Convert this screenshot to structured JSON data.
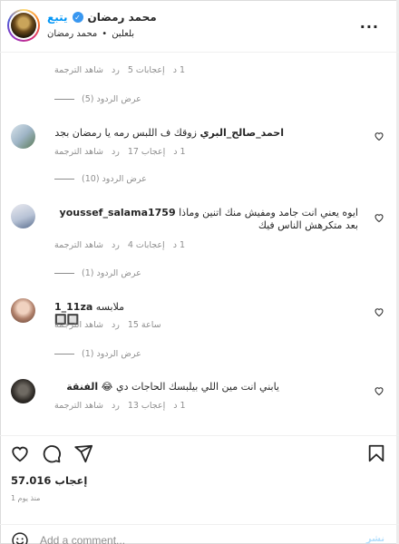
{
  "header": {
    "follow_label": "يتبع",
    "username": "محمد رمضان",
    "sub_location": "محمد رمضان",
    "sub_separator": "•",
    "sub_tag": "بلعلبن",
    "more_icon": "more-horizontal-icon"
  },
  "comments": [
    {
      "meta": {
        "time": "1 د",
        "likes": "إعجابات 5",
        "reply": "رد",
        "translate": "شاهد الترجمة"
      },
      "view_replies": "عرض الردود (5)"
    },
    {
      "username": "احمد_صالح_البري",
      "text": "زوقك ف اللبس رمه يا رمضان بجد",
      "meta": {
        "time": "1 د",
        "likes": "إعجاب 17",
        "reply": "رد",
        "translate": "شاهد الترجمة"
      },
      "view_replies": "عرض الردود (10)"
    },
    {
      "username": "youssef_salama1759",
      "text_line1": "ايوه يعني انت جامد ومفيش منك اتنين وماذا",
      "text_line2": "بعد متكرهش الناس فيك",
      "meta": {
        "time": "1 د",
        "likes": "إعجابات 4",
        "reply": "رد",
        "translate": "شاهد الترجمة"
      },
      "view_replies": "عرض الردود (1)"
    },
    {
      "username": "1_11za",
      "text": "ملابسه 🔲🔲",
      "meta": {
        "time": "ساعة 15",
        "reply": "رد",
        "translate": "شاهد الترجمة"
      },
      "view_replies": "عرض الردود (1)"
    },
    {
      "username": "الفنقة",
      "text": "يابني انت مين اللي بيلبسك الحاجات دي 😂",
      "meta": {
        "time": "1 د",
        "likes": "إعجاب 13",
        "reply": "رد",
        "translate": "شاهد الترجمة"
      }
    }
  ],
  "actions": {
    "likes": "57.016 إعجاب",
    "time": "منذ يوم 1"
  },
  "add_comment": {
    "placeholder": "Add a comment...",
    "post_label": "نشر"
  },
  "colors": {
    "accent": "#0095f6",
    "muted": "#8e8e8e",
    "verified": "#3897f0"
  }
}
